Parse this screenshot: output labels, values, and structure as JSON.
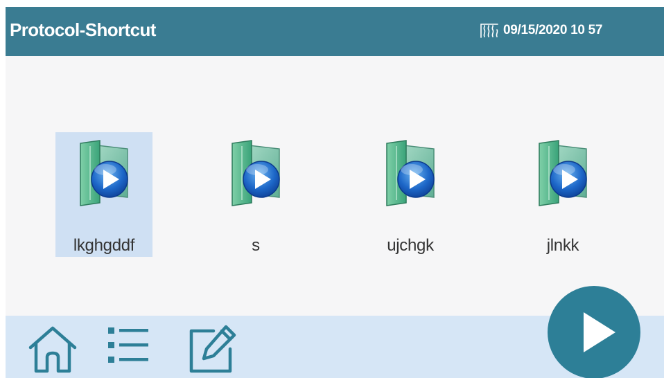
{
  "header": {
    "title": "Protocol-Shortcut",
    "datetime": "09/15/2020 10 57",
    "status_icon": "heater-icon",
    "background_color": "#3a7c92"
  },
  "shortcuts": [
    {
      "label": "lkghgddf",
      "icon": "protocol-file-icon",
      "selected": true
    },
    {
      "label": "s",
      "icon": "protocol-file-icon",
      "selected": false
    },
    {
      "label": "ujchgk",
      "icon": "protocol-file-icon",
      "selected": false
    },
    {
      "label": "jlnkk",
      "icon": "protocol-file-icon",
      "selected": false
    }
  ],
  "toolbar": {
    "buttons": [
      {
        "icon": "home-icon"
      },
      {
        "icon": "list-icon"
      },
      {
        "icon": "edit-icon"
      }
    ],
    "run_icon": "play-icon",
    "background_color": "#d6e6f6",
    "run_color": "#2d7f97"
  },
  "colors": {
    "accent": "#3a7c92",
    "selection": "#cfe0f3",
    "icon_stroke": "#2d7f97",
    "background": "#f6f6f7"
  }
}
